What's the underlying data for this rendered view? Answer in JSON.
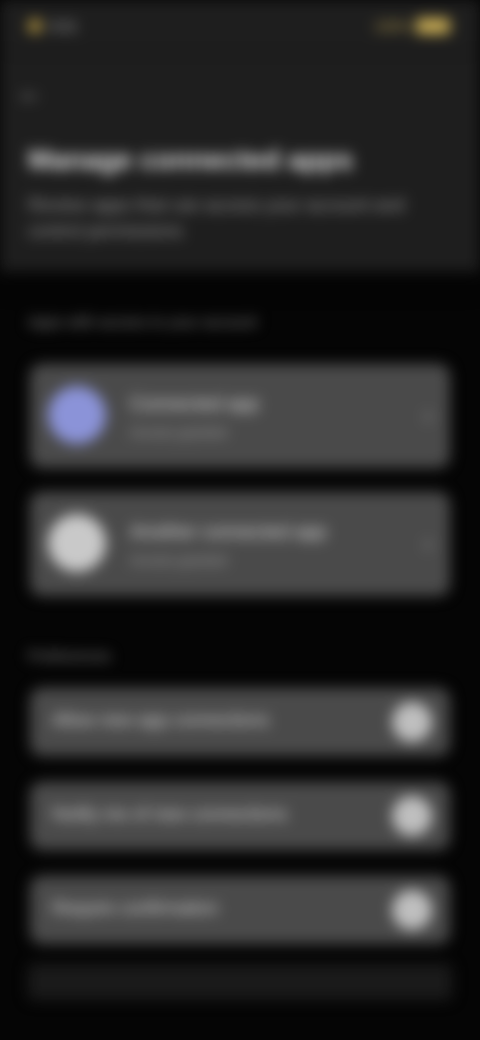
{
  "status_bar": {
    "time": "9:41",
    "battery_label": "100%"
  },
  "header": {
    "back_icon": "arrow-back-icon",
    "title": "Manage connected apps",
    "subtitle": "Review apps that can access your account and control permissions"
  },
  "connected_section": {
    "label": "Apps with access to your account",
    "apps": [
      {
        "name": "Connected app",
        "sub": "Access granted",
        "avatar_color": "#8b93d8"
      },
      {
        "name": "Another connected app",
        "sub": "Access granted",
        "avatar_color": "#c9c9c9"
      }
    ]
  },
  "preferences_section": {
    "label": "Preferences",
    "items": [
      {
        "label": "Allow new app connections"
      },
      {
        "label": "Notify me of new connections"
      },
      {
        "label": "Require confirmation"
      }
    ]
  },
  "colors": {
    "panel": "#1e1e1e",
    "background": "#050505",
    "card": "#4a4a4a",
    "accent": "#c9ad55"
  }
}
